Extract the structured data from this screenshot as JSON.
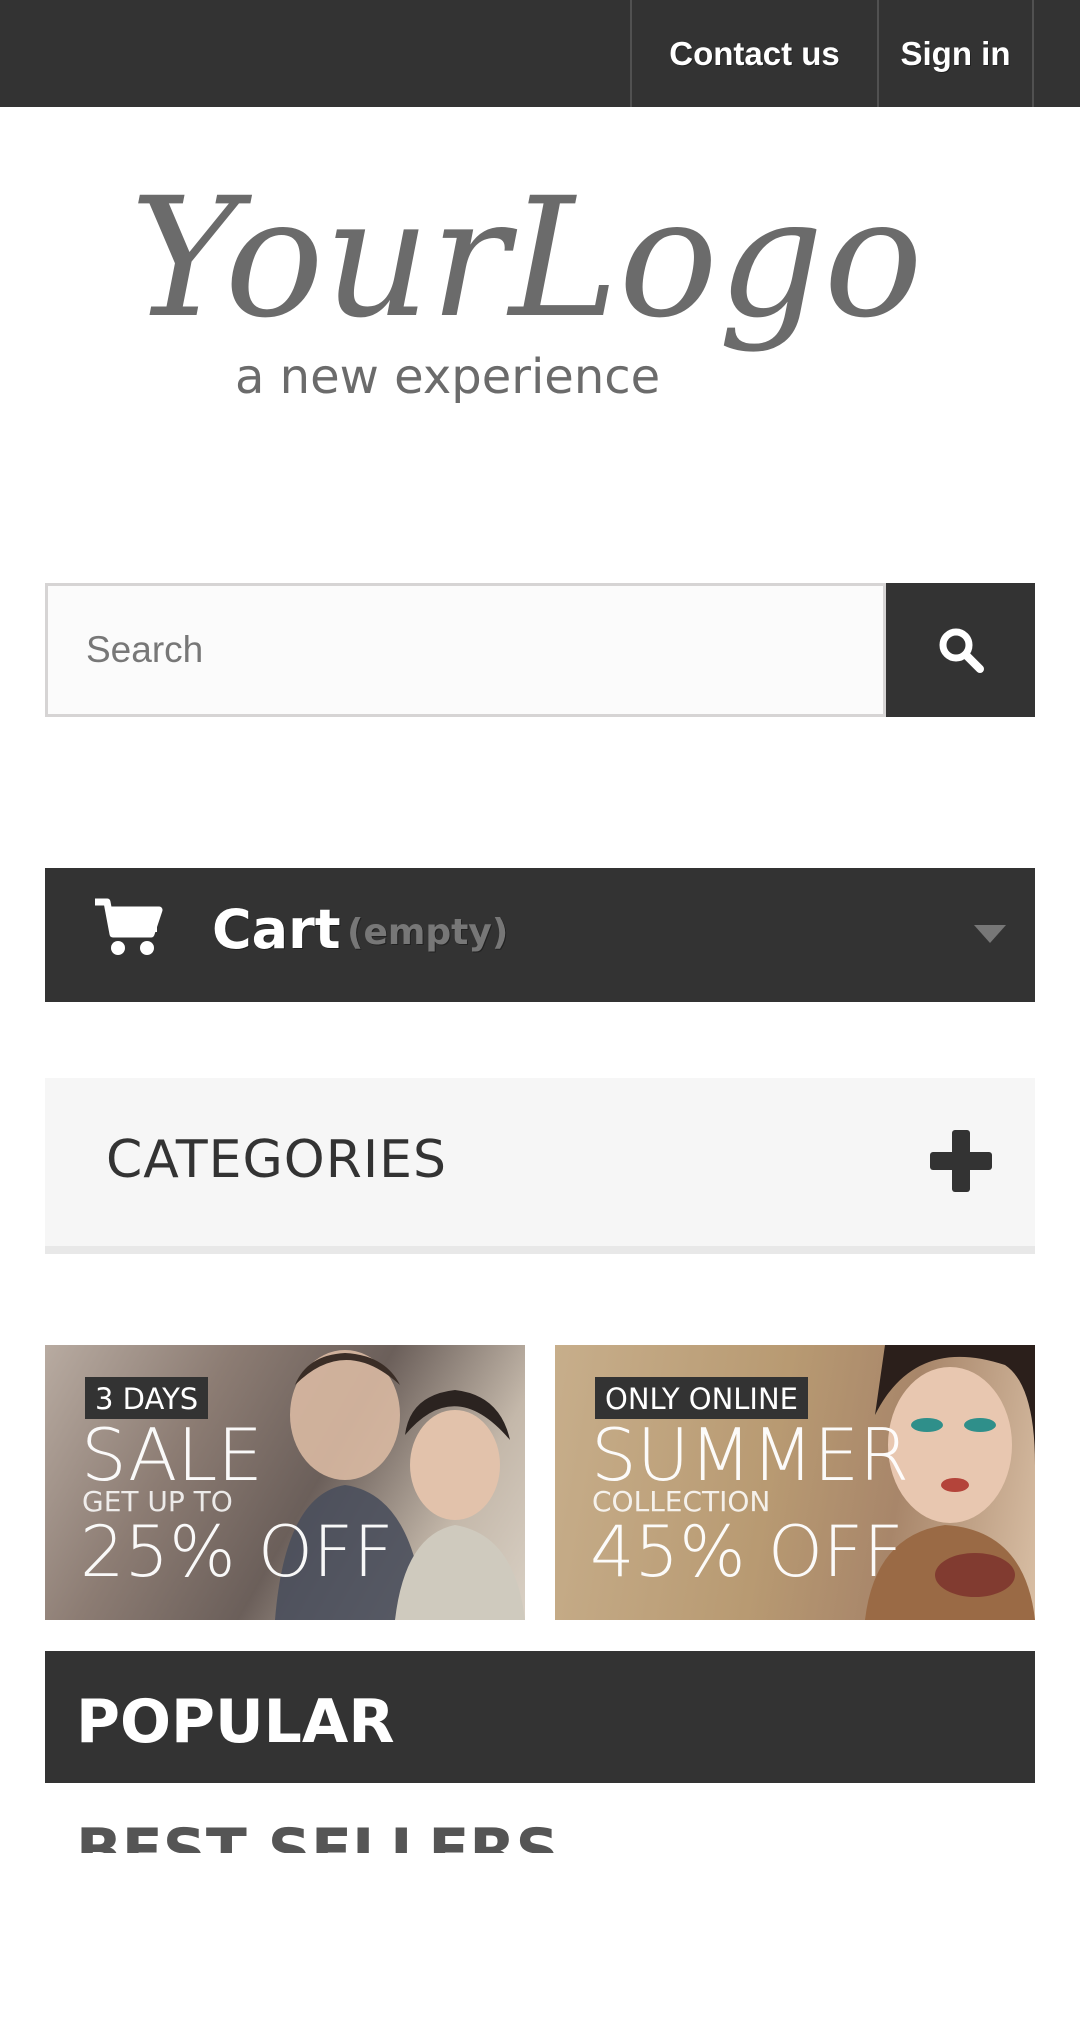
{
  "header": {
    "contact_label": "Contact us",
    "signin_label": "Sign in"
  },
  "logo": {
    "title": "YourLogo",
    "tagline": "a new experience"
  },
  "search": {
    "placeholder": "Search",
    "icon": "search-icon"
  },
  "cart": {
    "label": "Cart",
    "status": "(empty)",
    "icon": "cart-icon",
    "dropdown_icon": "caret-down-icon"
  },
  "categories": {
    "title": "CATEGORIES",
    "toggle_icon": "plus-icon"
  },
  "banners": [
    {
      "tag": "3 DAYS",
      "headline": "SALE",
      "subline": "GET UP TO",
      "offer": "25% OFF"
    },
    {
      "tag": "ONLY ONLINE",
      "headline": "SUMMER",
      "subline": "COLLECTION",
      "offer": "45% OFF"
    }
  ],
  "tabs": {
    "popular": "POPULAR",
    "best_sellers": "BEST SELLERS"
  },
  "colors": {
    "dark": "#333333",
    "light_panel": "#f6f6f6",
    "muted_text": "#777777"
  }
}
